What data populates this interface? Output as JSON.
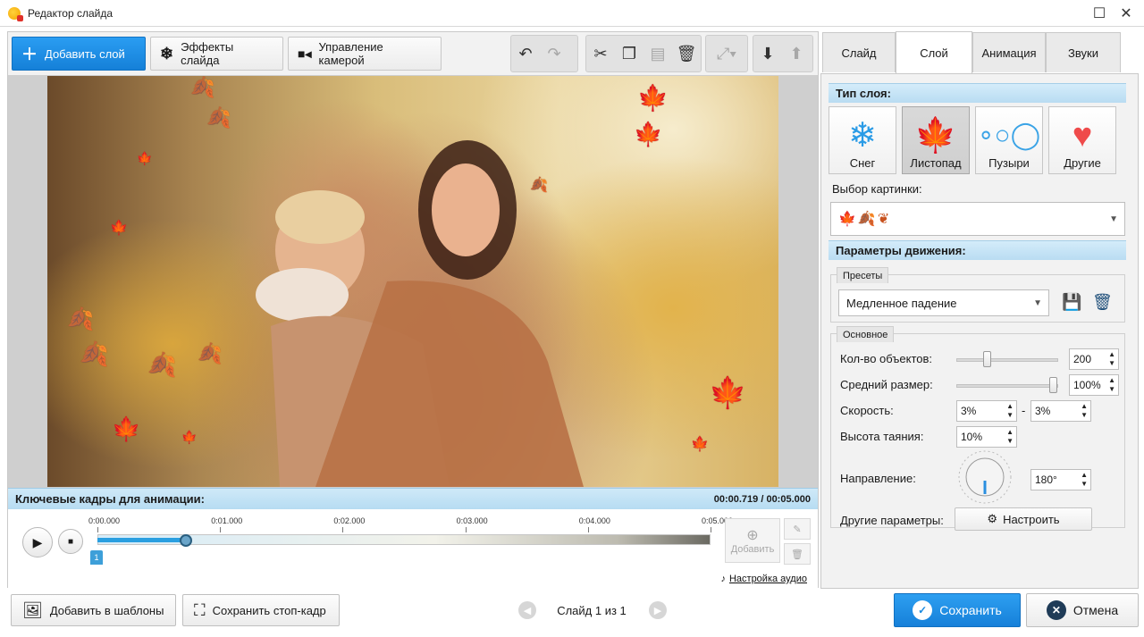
{
  "window": {
    "title": "Редактор слайда"
  },
  "toolbar": {
    "add_layer": "Добавить слой",
    "slide_effects": "Эффекты слайда",
    "camera_control": "Управление камерой"
  },
  "keyframes": {
    "title": "Ключевые кадры для анимации:",
    "time": "00:00.719 / 00:05.000",
    "ticks": [
      "0:00.000",
      "0:01.000",
      "0:02.000",
      "0:03.000",
      "0:04.000",
      "0:05.000"
    ],
    "progress": 0.1438,
    "marker": "1",
    "add_label": "Добавить",
    "audio_settings": "Настройка аудио"
  },
  "tabs": [
    "Слайд",
    "Слой",
    "Анимация",
    "Звуки"
  ],
  "layer": {
    "type_title": "Тип слоя:",
    "types": [
      "Снег",
      "Листопад",
      "Пузыри",
      "Другие"
    ],
    "picture_label": "Выбор картинки:",
    "motion_title": "Параметры движения:",
    "presets_title": "Пресеты",
    "preset_value": "Медленное падение",
    "basic_title": "Основное",
    "count_label": "Кол-во объектов:",
    "count_value": "200",
    "size_label": "Средний размер:",
    "size_value": "100%",
    "speed_label": "Скорость:",
    "speed_min": "3%",
    "speed_sep": "-",
    "speed_max": "3%",
    "melt_label": "Высота таяния:",
    "melt_value": "10%",
    "direction_label": "Направление:",
    "direction_value": "180°",
    "other_label": "Другие параметры:",
    "configure": "Настроить"
  },
  "bottom": {
    "add_templates": "Добавить в шаблоны",
    "save_frame": "Сохранить стоп-кадр",
    "slide_counter": "Слайд 1 из 1",
    "save": "Сохранить",
    "cancel": "Отмена"
  },
  "colors": {
    "accent": "#1a8ae0",
    "leaf": "#d86a2a",
    "heart": "#ef4b4b",
    "snow": "#2a9be6"
  }
}
